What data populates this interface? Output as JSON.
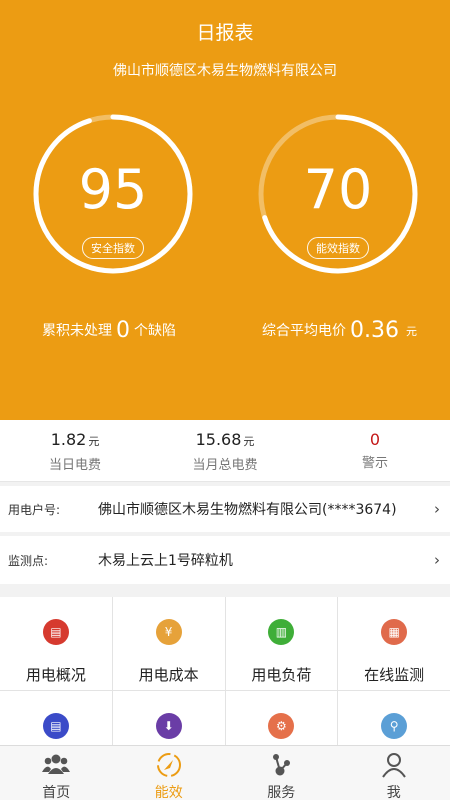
{
  "header": {
    "title": "日报表",
    "company": "佛山市顺德区木易生物燃料有限公司"
  },
  "gauges": [
    {
      "value": "95",
      "label": "安全指数",
      "progress": 0.95
    },
    {
      "value": "70",
      "label": "能效指数",
      "progress": 0.7
    }
  ],
  "summary": {
    "left": {
      "prefix": "累积未处理",
      "value": "0",
      "suffix": "个缺陷"
    },
    "right": {
      "prefix": "综合平均电价",
      "value": "0.36",
      "unit": "元"
    }
  },
  "stats": [
    {
      "value": "1.82",
      "unit": "元",
      "label": "当日电费"
    },
    {
      "value": "15.68",
      "unit": "元",
      "label": "当月总电费"
    },
    {
      "value": "0",
      "unit": "",
      "label": "警示"
    }
  ],
  "account_row": {
    "label": "用电户号:",
    "value": "佛山市顺德区木易生物燃料有限公司(****3674)"
  },
  "point_row": {
    "label": "监测点:",
    "value": "木易上云上1号碎粒机"
  },
  "tiles": [
    {
      "label": "用电概况",
      "icon": "report-icon",
      "color": "#d63a2f",
      "glyph": "▤"
    },
    {
      "label": "用电成本",
      "icon": "yuan-coin-icon",
      "color": "#e6a23a",
      "glyph": "¥"
    },
    {
      "label": "用电负荷",
      "icon": "load-chart-icon",
      "color": "#3fae38",
      "glyph": "▥"
    },
    {
      "label": "在线监测",
      "icon": "monitor-doc-icon",
      "color": "#e06a4b",
      "glyph": "▦"
    },
    {
      "label": "",
      "icon": "document-icon",
      "color": "#3b4bc8",
      "glyph": "▤"
    },
    {
      "label": "",
      "icon": "info-download-icon",
      "color": "#6a3da6",
      "glyph": "⬇"
    },
    {
      "label": "",
      "icon": "gear-icon",
      "color": "#e5704a",
      "glyph": "⚙"
    },
    {
      "label": "",
      "icon": "search-icon",
      "color": "#5b9fd6",
      "glyph": "⚲"
    }
  ],
  "tabs": [
    {
      "label": "首页",
      "icon": "people-icon",
      "active": false
    },
    {
      "label": "能效",
      "icon": "compass-icon",
      "active": true
    },
    {
      "label": "服务",
      "icon": "share-nodes-icon",
      "active": false
    },
    {
      "label": "我",
      "icon": "person-icon",
      "active": false
    }
  ],
  "colors": {
    "accent": "#ec9c13",
    "alarm": "#c41818"
  }
}
